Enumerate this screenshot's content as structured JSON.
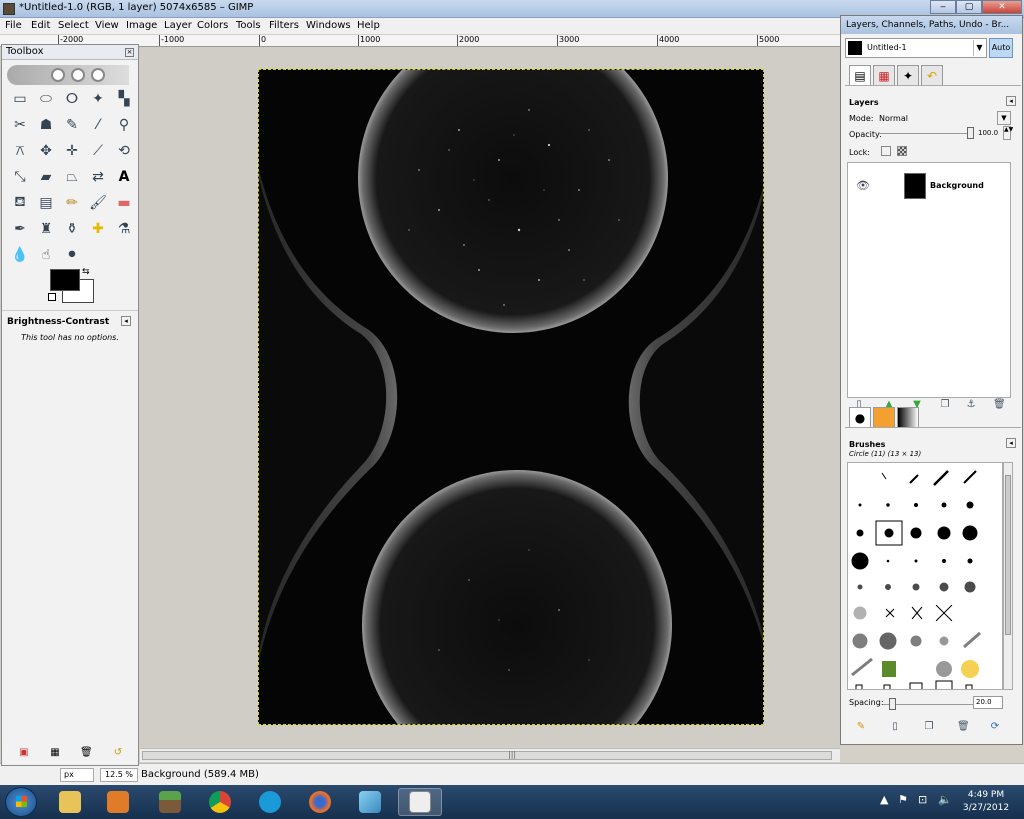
{
  "window": {
    "title": "*Untitled-1.0 (RGB, 1 layer) 5074x6585 – GIMP"
  },
  "menu": [
    "File",
    "Edit",
    "Select",
    "View",
    "Image",
    "Layer",
    "Colors",
    "Tools",
    "Filters",
    "Windows",
    "Help"
  ],
  "ruler": {
    "labels": [
      "-2000",
      "-1000",
      "0",
      "1000",
      "2000",
      "3000",
      "4000",
      "5000"
    ]
  },
  "toolbox": {
    "title": "Toolbox",
    "tool_options_title": "Brightness-Contrast",
    "tool_options_message": "This tool has no options."
  },
  "status": {
    "unit": "px",
    "zoom": "12.5 %",
    "message": "Background (589.4 MB)"
  },
  "dock": {
    "title": "Layers, Channels, Paths, Undo - Br...",
    "image_select": "Untitled-1",
    "auto_label": "Auto",
    "layers": {
      "title": "Layers",
      "mode_label": "Mode:",
      "mode_value": "Normal",
      "opacity_label": "Opacity:",
      "opacity_value": "100.0",
      "lock_label": "Lock:",
      "items": [
        {
          "name": "Background",
          "visible": true
        }
      ]
    },
    "brushes": {
      "title": "Brushes",
      "current": "Circle (11) (13 × 13)",
      "spacing_label": "Spacing:",
      "spacing_value": "20.0"
    }
  },
  "taskbar": {
    "time": "4:49 PM",
    "date": "3/27/2012"
  },
  "colors": {
    "foreground": "#000000",
    "background": "#ffffff",
    "canvas": "#050505"
  }
}
